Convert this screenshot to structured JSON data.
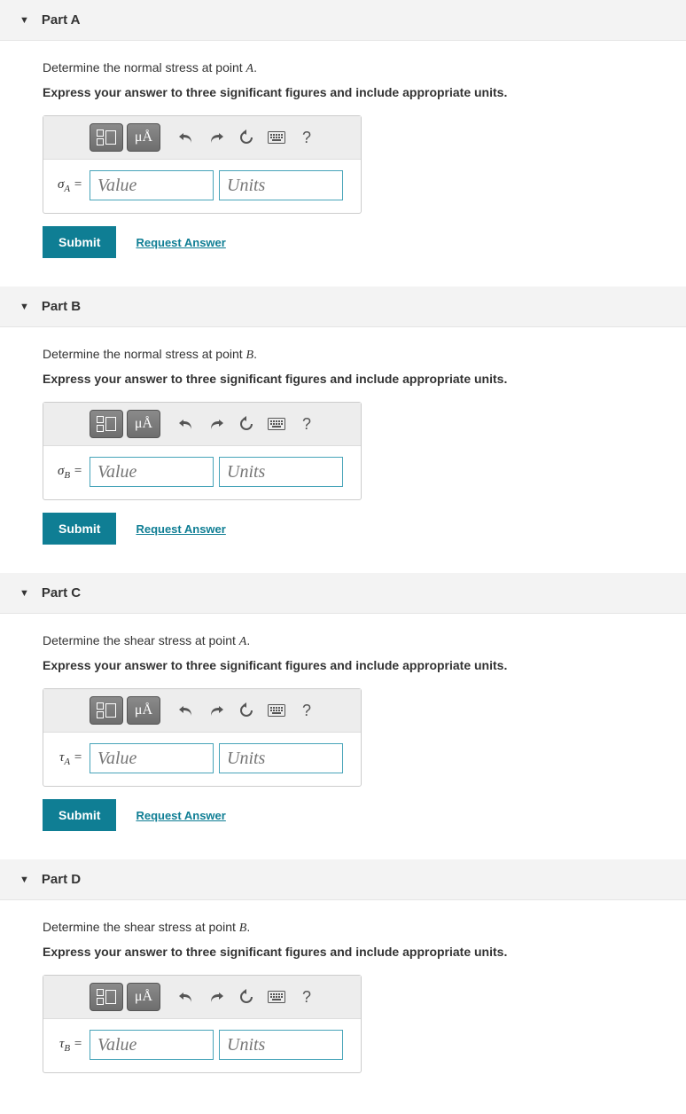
{
  "common": {
    "instruction": "Express your answer to three significant figures and include appropriate units.",
    "value_placeholder": "Value",
    "units_placeholder": "Units",
    "submit_label": "Submit",
    "request_label": "Request Answer",
    "toolbar": {
      "units_symbol": "μÅ",
      "undo": "↶",
      "redo": "↷",
      "reset": "↺",
      "keyboard": "⌨",
      "help": "?"
    }
  },
  "parts": [
    {
      "title": "Part A",
      "prompt_prefix": "Determine the normal stress at point ",
      "prompt_point": "A",
      "var_symbol": "σ",
      "var_sub": "A"
    },
    {
      "title": "Part B",
      "prompt_prefix": "Determine the normal stress at point ",
      "prompt_point": "B",
      "var_symbol": "σ",
      "var_sub": "B"
    },
    {
      "title": "Part C",
      "prompt_prefix": "Determine the shear stress at point ",
      "prompt_point": "A",
      "var_symbol": "τ",
      "var_sub": "A"
    },
    {
      "title": "Part D",
      "prompt_prefix": "Determine the shear stress at point ",
      "prompt_point": "B",
      "var_symbol": "τ",
      "var_sub": "B"
    }
  ]
}
